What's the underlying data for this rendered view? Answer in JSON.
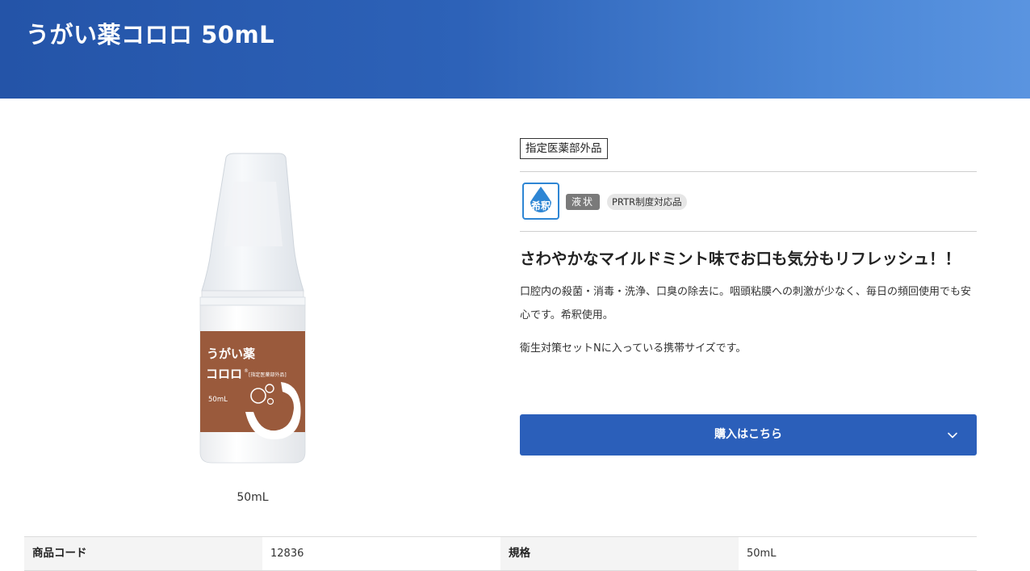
{
  "header": {
    "title": "うがい薬コロロ 50mL"
  },
  "product": {
    "label_name": "うがい薬",
    "label_brand": "コロロ",
    "label_registered": "®",
    "label_category": "[指定医薬部外品]",
    "label_volume": "50mL",
    "caption": "50mL"
  },
  "info": {
    "category": "指定医薬部外品",
    "dilute_icon_text": "希釈",
    "tag_liquid": "液状",
    "tag_prtr": "PRTR制度対応品",
    "catchcopy": "さわやかなマイルドミント味でお口も気分もリフレッシュ！！",
    "description1": "口腔内の殺菌・消毒・洗浄、口臭の除去に。咽頭粘膜への刺激が少なく、毎日の頻回使用でも安心です。希釈使用。",
    "description2": "衛生対策セットNに入っている携帯サイズです。",
    "buy_label": "購入はこちら"
  },
  "spec": {
    "code_label": "商品コード",
    "code_value": "12836",
    "size_label": "規格",
    "size_value": "50mL"
  },
  "colors": {
    "header_start": "#2454a8",
    "header_end": "#5a94e0",
    "button": "#2b5fba",
    "label_brown": "#9a5a3c",
    "icon_blue": "#2e86d4"
  }
}
